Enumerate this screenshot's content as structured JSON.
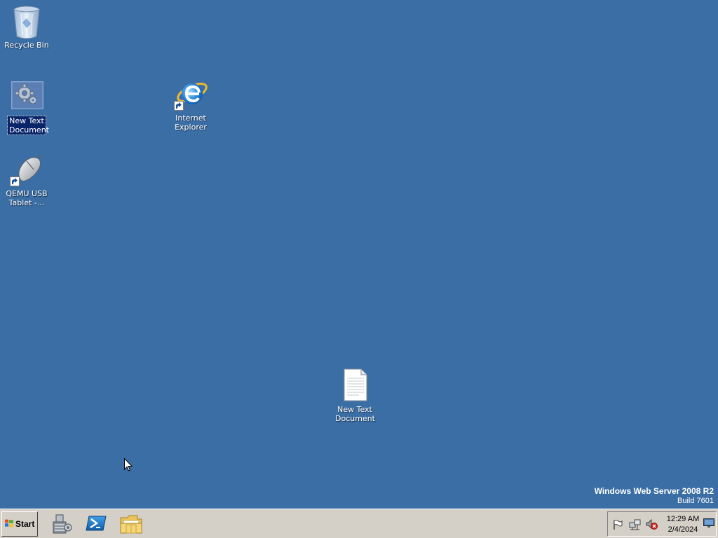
{
  "desktop": {
    "background_color": "#3b6ea5",
    "icons": [
      {
        "label": "Recycle Bin",
        "icon": "recycle-bin-icon"
      },
      {
        "label": "New Text Document",
        "icon": "gear-settings-icon",
        "selected": true
      },
      {
        "label": "Internet Explorer",
        "icon": "internet-explorer-icon",
        "shortcut": true
      },
      {
        "label": "QEMU USB Tablet -...",
        "icon": "usb-tablet-mouse-icon",
        "shortcut": true
      },
      {
        "label": "New Text Document",
        "icon": "text-document-icon"
      }
    ],
    "watermark": {
      "title": "Windows Web Server 2008 R2",
      "build": "Build 7601"
    }
  },
  "taskbar": {
    "start_label": "Start",
    "quick_launch": [
      {
        "name": "server-manager",
        "icon": "server-manager-icon"
      },
      {
        "name": "powershell",
        "icon": "powershell-icon"
      },
      {
        "name": "windows-explorer",
        "icon": "folder-icon"
      }
    ],
    "tray": {
      "icons": [
        "action-center-flag-icon",
        "network-icon",
        "volume-muted-icon"
      ],
      "time": "12:29 AM",
      "date": "2/4/2024",
      "show_desktop_icon": "show-desktop-icon"
    }
  }
}
